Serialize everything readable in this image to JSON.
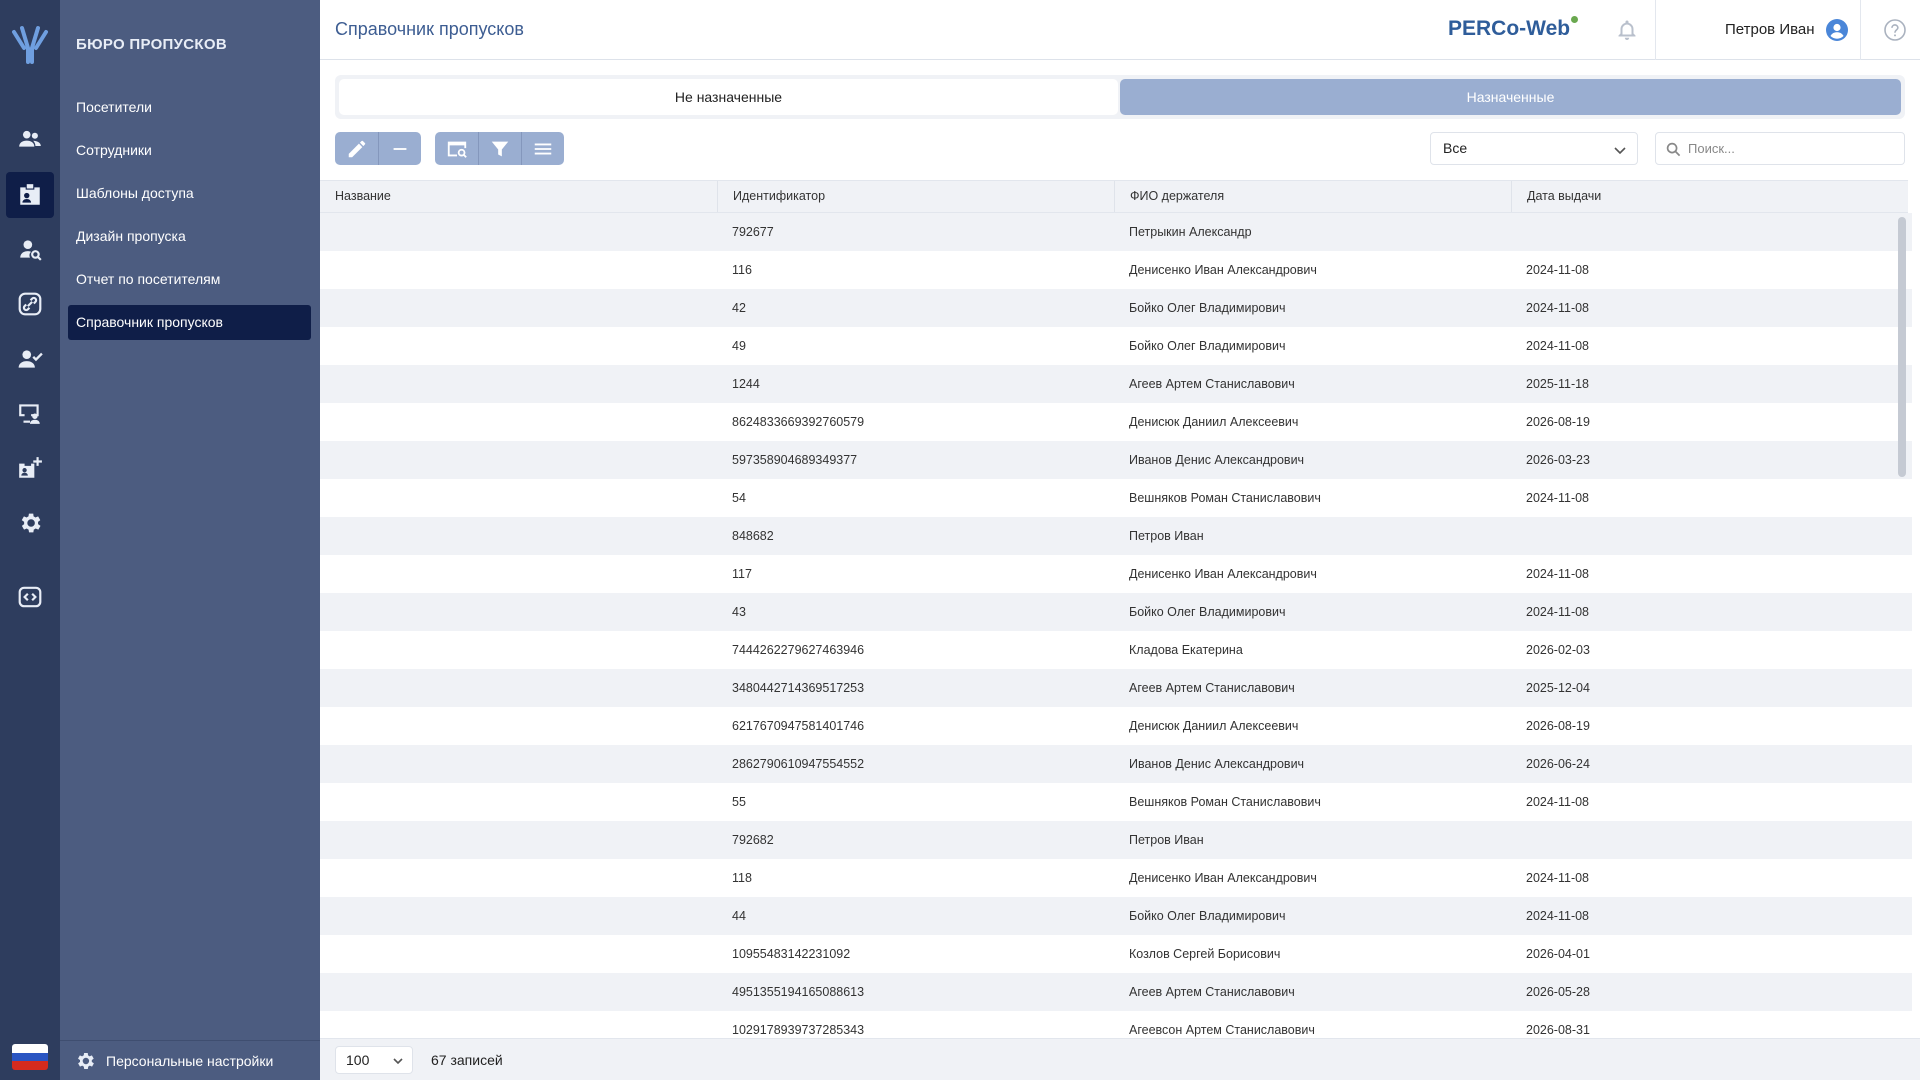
{
  "header": {
    "page_title": "Справочник пропусков",
    "brand": "PERCo-Web",
    "user_name": "Петров Иван"
  },
  "sidebar": {
    "section_title": "БЮРО ПРОПУСКОВ",
    "items": [
      {
        "label": "Посетители"
      },
      {
        "label": "Сотрудники"
      },
      {
        "label": "Шаблоны доступа"
      },
      {
        "label": "Дизайн пропуска"
      },
      {
        "label": "Отчет по посетителям"
      },
      {
        "label": "Справочник пропусков"
      }
    ],
    "active_index": 5,
    "footer_label": "Персональные настройки"
  },
  "rail_icons": [
    "people-icon",
    "badge-icon",
    "visitor-search-icon",
    "link-icon",
    "user-check-icon",
    "monitor-user-icon",
    "add-badge-icon",
    "gear-icon",
    "code-icon"
  ],
  "tabs": [
    {
      "label": "Не назначенные"
    },
    {
      "label": "Назначенные"
    }
  ],
  "filter": {
    "selected": "Все",
    "search_placeholder": "Поиск..."
  },
  "table": {
    "columns": [
      "Название",
      "Идентификатор",
      "ФИО держателя",
      "Дата выдачи"
    ],
    "rows": [
      [
        "",
        "792677",
        "Петрыкин Александр",
        ""
      ],
      [
        "",
        "116",
        "Денисенко Иван Александрович",
        "2024-11-08"
      ],
      [
        "",
        "42",
        "Бойко Олег Владимирович",
        "2024-11-08"
      ],
      [
        "",
        "49",
        "Бойко Олег Владимирович",
        "2024-11-08"
      ],
      [
        "",
        "1244",
        "Агеев Артем Станиславович",
        "2025-11-18"
      ],
      [
        "",
        "8624833669392760579",
        "Денисюк Даниил Алексеевич",
        "2026-08-19"
      ],
      [
        "",
        "597358904689349377",
        "Иванов Денис Александрович",
        "2026-03-23"
      ],
      [
        "",
        "54",
        "Вешняков Роман Станиславович",
        "2024-11-08"
      ],
      [
        "",
        "848682",
        "Петров Иван",
        ""
      ],
      [
        "",
        "117",
        "Денисенко Иван Александрович",
        "2024-11-08"
      ],
      [
        "",
        "43",
        "Бойко Олег Владимирович",
        "2024-11-08"
      ],
      [
        "",
        "7444262279627463946",
        "Кладова Екатерина",
        "2026-02-03"
      ],
      [
        "",
        "3480442714369517253",
        "Агеев Артем Станиславович",
        "2025-12-04"
      ],
      [
        "",
        "6217670947581401746",
        "Денисюк Даниил Алексеевич",
        "2026-08-19"
      ],
      [
        "",
        "2862790610947554552",
        "Иванов Денис Александрович",
        "2026-06-24"
      ],
      [
        "",
        "55",
        "Вешняков Роман Станиславович",
        "2024-11-08"
      ],
      [
        "",
        "792682",
        "Петров Иван",
        ""
      ],
      [
        "",
        "118",
        "Денисенко Иван Александрович",
        "2024-11-08"
      ],
      [
        "",
        "44",
        "Бойко Олег Владимирович",
        "2024-11-08"
      ],
      [
        "",
        "10955483142231092",
        "Козлов Сергей Борисович",
        "2026-04-01"
      ],
      [
        "",
        "4951355194165088613",
        "Агеев Артем Станиславович",
        "2026-05-28"
      ],
      [
        "",
        "1029178939737285343",
        "Агеевсон Артем Станиславович",
        "2026-08-31"
      ]
    ]
  },
  "footer": {
    "page_size": "100",
    "records": "67 записей"
  },
  "colors": {
    "rail": "#2e3d5e",
    "sidebar": "#4c5c80",
    "active": "#0f1e48",
    "accent": "#9aaed1",
    "brand": "#2f5d9a",
    "stripe": "#f0f2f6"
  }
}
